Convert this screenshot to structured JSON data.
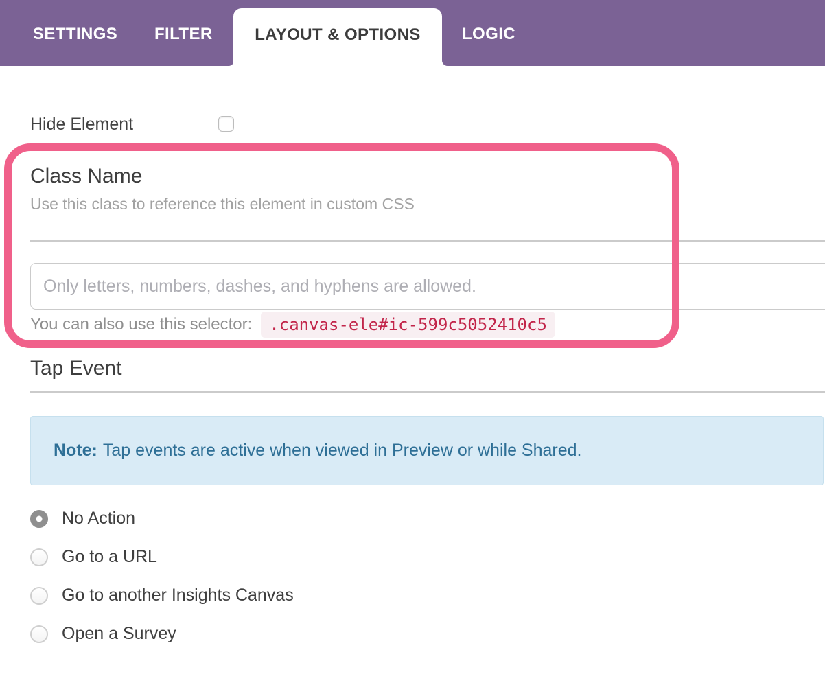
{
  "tabs": {
    "items": [
      {
        "label": "SETTINGS",
        "active": false
      },
      {
        "label": "FILTER",
        "active": false
      },
      {
        "label": "LAYOUT & OPTIONS",
        "active": true
      },
      {
        "label": "LOGIC",
        "active": false
      }
    ]
  },
  "hide_element": {
    "label": "Hide Element",
    "checked": false
  },
  "class_name_section": {
    "title": "Class Name",
    "subtitle": "Use this class to reference this element in custom CSS",
    "input_value": "",
    "input_placeholder": "Only letters, numbers, dashes, and hyphens are allowed.",
    "selector_hint_label": "You can also use this selector:",
    "selector_code": ".canvas-ele#ic-599c5052410c5"
  },
  "tap_event_section": {
    "title": "Tap Event",
    "note_label": "Note:",
    "note_text": "Tap events are active when viewed in Preview or while Shared.",
    "options": [
      {
        "label": "No Action",
        "selected": true
      },
      {
        "label": "Go to a URL",
        "selected": false
      },
      {
        "label": "Go to another Insights Canvas",
        "selected": false
      },
      {
        "label": "Open a Survey",
        "selected": false
      }
    ]
  },
  "colors": {
    "header_purple": "#7B6295",
    "highlight_pink": "#F0608A",
    "note_background": "#D9EBF6",
    "note_text": "#2E6F96",
    "code_text": "#C2254A",
    "code_background": "#F8EFF2"
  }
}
